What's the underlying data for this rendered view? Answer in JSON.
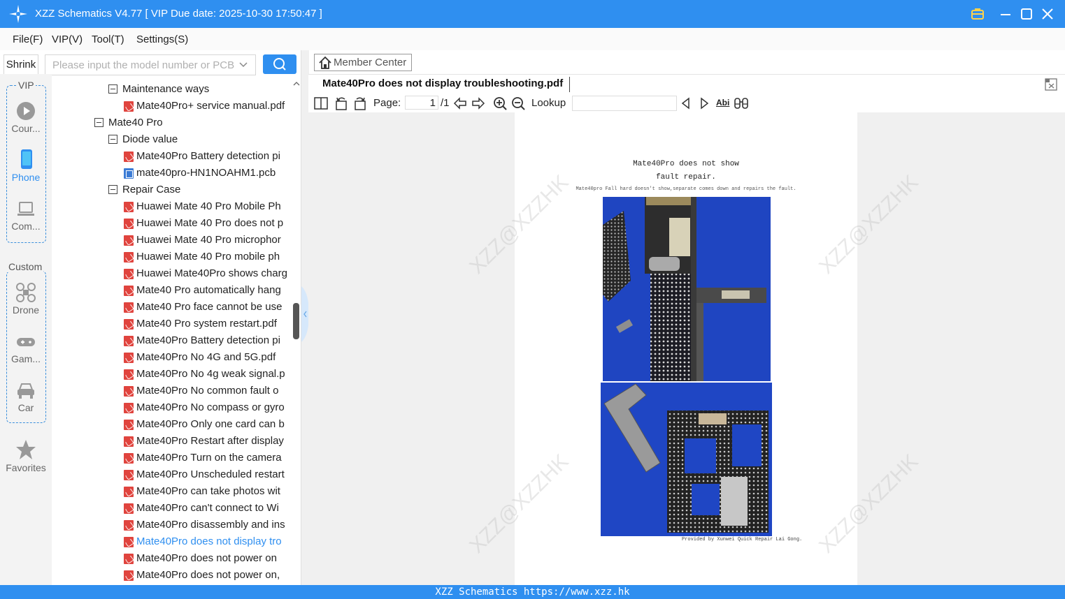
{
  "window": {
    "title": "XZZ Schematics V4.77 [ VIP Due date: 2025-10-30 17:50:47 ]"
  },
  "menu": [
    "File(F)",
    "VIP(V)",
    "Tool(T)",
    "Settings(S)"
  ],
  "search": {
    "shrink_label": "Shrink",
    "placeholder": "Please input the model number or PCB"
  },
  "sidebar": {
    "vip_caption": "VIP",
    "custom_caption": "Custom",
    "vip_items": [
      "Cour...",
      "Phone",
      "Com..."
    ],
    "custom_items": [
      "Drone",
      "Gam...",
      "Car"
    ],
    "favorites": "Favorites"
  },
  "tree": [
    {
      "label": "Maintenance ways",
      "type": "folder",
      "level": 2
    },
    {
      "label": "Mate40Pro+ service manual.pdf",
      "type": "pdf",
      "level": 3
    },
    {
      "label": "Mate40 Pro",
      "type": "folder",
      "level": 1
    },
    {
      "label": "Diode value",
      "type": "folder",
      "level": 2
    },
    {
      "label": "Mate40Pro Battery detection pi",
      "type": "pdf",
      "level": 3
    },
    {
      "label": "mate40pro-HN1NOAHM1.pcb",
      "type": "pcb",
      "level": 3
    },
    {
      "label": "Repair Case",
      "type": "folder",
      "level": 2
    },
    {
      "label": "Huawei Mate 40 Pro Mobile Ph",
      "type": "pdf",
      "level": 3
    },
    {
      "label": "Huawei Mate 40 Pro does not p",
      "type": "pdf",
      "level": 3
    },
    {
      "label": "Huawei Mate 40 Pro microphor",
      "type": "pdf",
      "level": 3
    },
    {
      "label": "Huawei Mate 40 Pro mobile ph",
      "type": "pdf",
      "level": 3
    },
    {
      "label": "Huawei Mate40Pro shows charg",
      "type": "pdf",
      "level": 3
    },
    {
      "label": "Mate40 Pro automatically hang",
      "type": "pdf",
      "level": 3
    },
    {
      "label": "Mate40 Pro face cannot be use",
      "type": "pdf",
      "level": 3
    },
    {
      "label": "Mate40 Pro system restart.pdf",
      "type": "pdf",
      "level": 3
    },
    {
      "label": "Mate40Pro Battery detection pi",
      "type": "pdf",
      "level": 3
    },
    {
      "label": "Mate40Pro No 4G and 5G.pdf",
      "type": "pdf",
      "level": 3
    },
    {
      "label": "Mate40Pro No 4g weak signal.p",
      "type": "pdf",
      "level": 3
    },
    {
      "label": "Mate40Pro No common fault o",
      "type": "pdf",
      "level": 3
    },
    {
      "label": "Mate40Pro No compass or gyro",
      "type": "pdf",
      "level": 3
    },
    {
      "label": "Mate40Pro Only one card can b",
      "type": "pdf",
      "level": 3
    },
    {
      "label": "Mate40Pro Restart after display",
      "type": "pdf",
      "level": 3
    },
    {
      "label": "Mate40Pro Turn on the camera",
      "type": "pdf",
      "level": 3
    },
    {
      "label": "Mate40Pro Unscheduled restart",
      "type": "pdf",
      "level": 3
    },
    {
      "label": "Mate40Pro can take photos wit",
      "type": "pdf",
      "level": 3
    },
    {
      "label": "Mate40Pro can't connect to Wi",
      "type": "pdf",
      "level": 3
    },
    {
      "label": "Mate40Pro disassembly and ins",
      "type": "pdf",
      "level": 3
    },
    {
      "label": "Mate40Pro does not display tro",
      "type": "pdf",
      "level": 3,
      "selected": true
    },
    {
      "label": "Mate40Pro does not power on",
      "type": "pdf",
      "level": 3
    },
    {
      "label": "Mate40Pro does not power on,",
      "type": "pdf",
      "level": 3
    }
  ],
  "viewer": {
    "member_center": "Member Center",
    "tab_title": "Mate40Pro does not display troubleshooting.pdf",
    "page_label": "Page:",
    "page_current": "1",
    "page_total": "/1",
    "lookup_label": "Lookup",
    "abi_label": "Abi"
  },
  "document": {
    "title_line1": "Mate40Pro does not show",
    "title_line2": "fault repair.",
    "subtitle": "Mate40pro Fall hard doesn't show,separate comes down and repairs the fault.",
    "credit": "Provided by Xunwei Quick Repair Lai Gong.",
    "watermark": "XZZ@XZZHK"
  },
  "statusbar": {
    "text": "XZZ Schematics https://www.xzz.hk"
  },
  "colors": {
    "accent": "#2f8ff0",
    "selected": "#2f8ff0",
    "pdf_icon": "#e0443e"
  }
}
